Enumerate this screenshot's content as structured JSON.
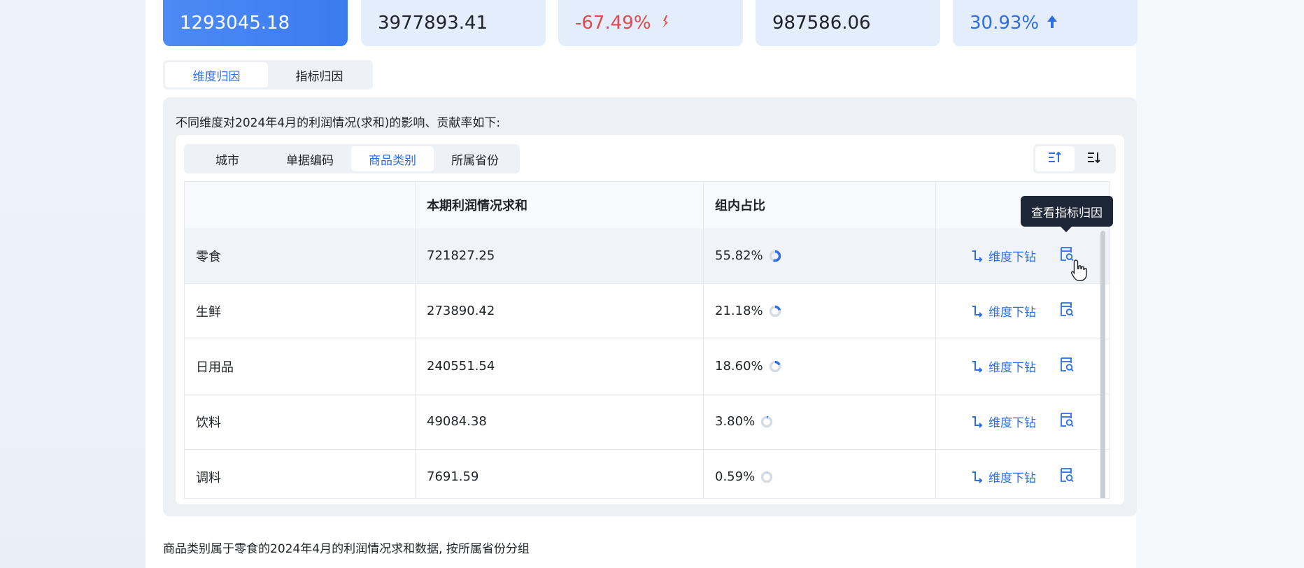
{
  "kpis": [
    {
      "value": "1293045.18"
    },
    {
      "value": "3977893.41"
    },
    {
      "value": "-67.49%",
      "trend": "down"
    },
    {
      "value": "987586.06"
    },
    {
      "value": "30.93%",
      "trend": "up"
    }
  ],
  "attribution_tabs": [
    "维度归因",
    "指标归因"
  ],
  "panel": {
    "description": "不同维度对2024年4月的利润情况(求和)的影响、贡献率如下:",
    "dimension_tabs": [
      "城市",
      "单据编码",
      "商品类别",
      "所属省份"
    ],
    "selected_dimension": "商品类别",
    "sort_icons": [
      "sort-ascending-icon",
      "sort-descending-icon"
    ],
    "table": {
      "columns": [
        "",
        "本期利润情况求和",
        "组内占比",
        ""
      ],
      "rows": [
        {
          "name": "零食",
          "value": "721827.25",
          "share": "55.82%",
          "fraction": 0.5582
        },
        {
          "name": "生鲜",
          "value": "273890.42",
          "share": "21.18%",
          "fraction": 0.2118
        },
        {
          "name": "日用品",
          "value": "240551.54",
          "share": "18.60%",
          "fraction": 0.186
        },
        {
          "name": "饮料",
          "value": "49084.38",
          "share": "3.80%",
          "fraction": 0.038
        },
        {
          "name": "调料",
          "value": "7691.59",
          "share": "0.59%",
          "fraction": 0.0059
        }
      ],
      "drill_label": "维度下钻"
    }
  },
  "tooltip": "查看指标归因",
  "footer_text": "商品类别属于零食的2024年4月的利润情况求和数据, 按所属省份分组",
  "colors": {
    "accent": "#2d6ee0",
    "negative": "#e04a4a",
    "tooltip_bg": "#1e2738"
  }
}
